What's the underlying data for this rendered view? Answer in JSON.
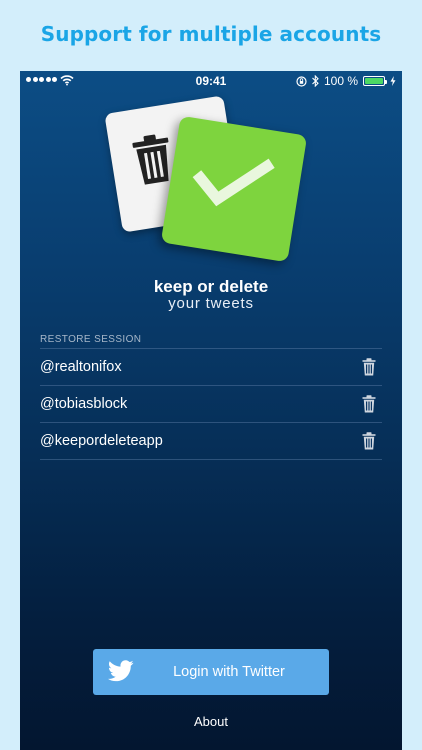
{
  "headline": "Support for multiple accounts",
  "status_bar": {
    "time": "09:41",
    "battery": "100 %",
    "battery_level": 1.0,
    "icons": [
      "signal-dots-icon",
      "wifi-icon",
      "rotation-lock-icon",
      "bluetooth-icon",
      "battery-icon",
      "charging-bolt-icon"
    ]
  },
  "brand": {
    "title": "keep or delete",
    "subtitle": "your tweets",
    "logo_icons": [
      "trash-icon",
      "check-icon"
    ]
  },
  "restore": {
    "label": "RESTORE SESSION",
    "accounts": [
      {
        "handle": "@realtonifox",
        "icon": "trash-icon"
      },
      {
        "handle": "@tobiasblock",
        "icon": "trash-icon"
      },
      {
        "handle": "@keepordeleteapp",
        "icon": "trash-icon"
      }
    ]
  },
  "login_button": {
    "label": "Login with Twitter",
    "icon": "twitter-bird-icon"
  },
  "about_link": "About",
  "colors": {
    "headline": "#1aa5e6",
    "page_background": "#d3eefb",
    "screen_gradient_top": "#0c4d85",
    "screen_gradient_bottom": "#031630",
    "login_button": "#5aa9e8",
    "check_card": "#7ed43e",
    "battery_fill": "#4cd964"
  }
}
